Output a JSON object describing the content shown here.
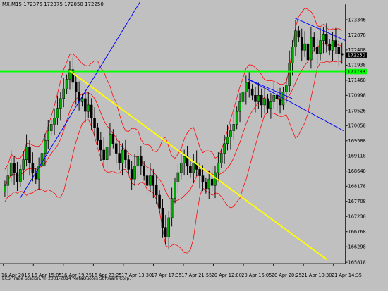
{
  "chart_header": {
    "symbol_timeframe": "MX,M15",
    "ohlc": "172375 172375 172050 172250"
  },
  "footer_copyright": "ECS Trade Station, © 2001-2014 MetaQuotes Software Corp.",
  "colors": {
    "background": "#c0c0c0",
    "bull_candle": "#00aa00",
    "bear_candle": "#000000",
    "bollinger": "#ff0000",
    "horizontal_level": "#00ff00",
    "yellow_trendline": "#ffff00",
    "blue_trendline": "#0000ff"
  },
  "chart_data": {
    "type": "candlestick",
    "y_ticks": [
      "173346",
      "172878",
      "172408",
      "171938",
      "171468",
      "170998",
      "170526",
      "170058",
      "169588",
      "169118",
      "168648",
      "168178",
      "167708",
      "167238",
      "166768",
      "166298",
      "165818"
    ],
    "x_ticks": [
      "16 Apr 2015",
      "16 Apr 15:05",
      "16 Apr 19:25",
      "16 Apr 23:25",
      "17 Apr 13:30",
      "17 Apr 17:35",
      "17 Apr 21:55",
      "20 Apr 12:00",
      "20 Apr 16:05",
      "20 Apr 20:25",
      "21 Apr 10:30",
      "21 Apr 14:35"
    ],
    "ylim": [
      165818,
      173346
    ],
    "current_price": "172250",
    "level_price": "171738",
    "candle_closes": [
      168200,
      168500,
      168900,
      168600,
      168300,
      168700,
      169000,
      169400,
      168900,
      168600,
      168400,
      168800,
      169200,
      169600,
      169900,
      170100,
      170300,
      170600,
      170900,
      171200,
      171500,
      171800,
      171400,
      171100,
      170800,
      170900,
      170500,
      170700,
      170300,
      170000,
      169600,
      169300,
      169000,
      169400,
      169800,
      169500,
      169200,
      168900,
      169300,
      169000,
      168700,
      168400,
      168800,
      169100,
      168800,
      168500,
      168200,
      168500,
      168200,
      167900,
      167500,
      166900,
      166600,
      167200,
      167800,
      168300,
      168600,
      168900,
      169100,
      168800,
      168600,
      168900,
      168700,
      168500,
      168300,
      168100,
      168400,
      168200,
      168600,
      168900,
      169200,
      169500,
      169700,
      169900,
      170100,
      170500,
      170800,
      171100,
      171400,
      171200,
      171000,
      170800,
      171000,
      170700,
      170900,
      170600,
      170800,
      171000,
      170900,
      170700,
      171100,
      171300,
      172000,
      172500,
      173000,
      172800,
      172400,
      172600,
      172100,
      172800,
      172500,
      172300,
      172700,
      172900,
      172600,
      172400,
      172700,
      172500,
      172300,
      172250
    ]
  }
}
